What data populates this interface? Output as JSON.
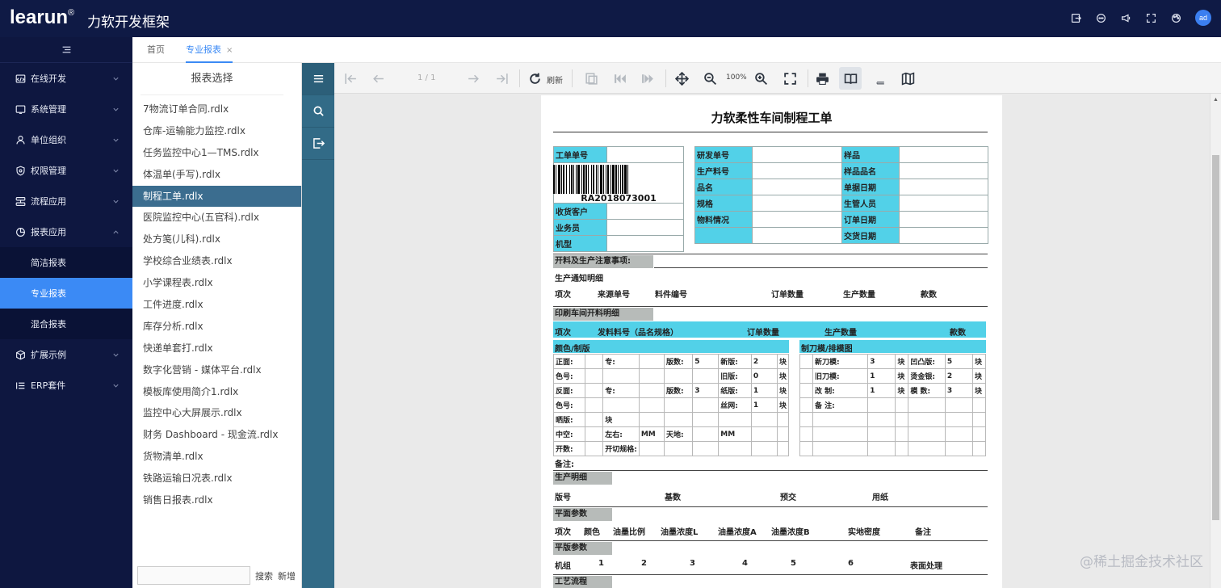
{
  "app": {
    "logo": "learun",
    "logo_mark": "®",
    "subtitle": "力软开发框架",
    "avatar": "ad"
  },
  "topbar_icons": [
    "export-icon",
    "message-icon",
    "notice-icon",
    "fullscreen-icon",
    "theme-icon"
  ],
  "sidebar": {
    "items": [
      {
        "label": "在线开发",
        "icon": "code-icon"
      },
      {
        "label": "系统管理",
        "icon": "settings-icon"
      },
      {
        "label": "单位组织",
        "icon": "org-icon"
      },
      {
        "label": "权限管理",
        "icon": "shield-icon"
      },
      {
        "label": "流程应用",
        "icon": "flow-icon"
      },
      {
        "label": "报表应用",
        "icon": "chart-icon"
      }
    ],
    "sub_items": [
      "简洁报表",
      "专业报表",
      "混合报表"
    ],
    "items_after": [
      {
        "label": "扩展示例",
        "icon": "box-icon"
      },
      {
        "label": "ERP套件",
        "icon": "list-icon"
      }
    ]
  },
  "tabs": {
    "home": "首页",
    "active": "专业报表",
    "close": "×"
  },
  "report_list": {
    "title": "报表选择",
    "items": [
      "7物流订单合同.rdlx",
      "仓库-运输能力监控.rdlx",
      "任务监控中心1—TMS.rdlx",
      "体温单(手写).rdlx",
      "制程工单.rdlx",
      "医院监控中心(五官科).rdlx",
      "处方笺(儿科).rdlx",
      "学校综合业绩表.rdlx",
      "小学课程表.rdlx",
      "工件进度.rdlx",
      "库存分析.rdlx",
      "快递单套打.rdlx",
      "数字化营销 - 媒体平台.rdlx",
      "模板库使用简介1.rdlx",
      "监控中心大屏展示.rdlx",
      "财务 Dashboard - 现金流.rdlx",
      "货物清单.rdlx",
      "铁路运输日况表.rdlx",
      "销售日报表.rdlx"
    ],
    "search_label": "搜索",
    "add_label": "新增"
  },
  "toolbar": {
    "page": "1 / 1",
    "refresh": "刷新",
    "zoom": "100%"
  },
  "report": {
    "title": "力软柔性车间制程工单",
    "barcode": "RA2018073001",
    "left_fields": [
      "工单单号",
      "收货客户",
      "业务员",
      "机型"
    ],
    "mid_fields": [
      "研发单号",
      "生产料号",
      "品名",
      "规格",
      "物料情况"
    ],
    "right_fields": [
      "样品",
      "样品品名",
      "单据日期",
      "生管人员",
      "订单日期",
      "交货日期"
    ],
    "notice": "开料及生产注意事项:",
    "prod_notice": "生产通知明细",
    "prod_cols": [
      "项次",
      "来源单号",
      "料件编号",
      "订单数量",
      "生产数量",
      "款数"
    ],
    "print_title": "印刷车间开料明细",
    "print_cols": [
      "项次",
      "发料料号（品名规格）",
      "订单数量",
      "生产数量",
      "款数"
    ],
    "color_title": "颜色/制版",
    "knife_title": "制刀模/排模图",
    "color_rows": [
      [
        "正面:",
        "",
        "专:",
        "",
        "版数:",
        "5",
        "新版:",
        "2",
        "块"
      ],
      [
        "色号:",
        "",
        "",
        "",
        "",
        "",
        "旧版:",
        "0",
        "块"
      ],
      [
        "反面:",
        "",
        "专:",
        "",
        "版数:",
        "3",
        "纸版:",
        "1",
        "块"
      ],
      [
        "色号:",
        "",
        "",
        "",
        "",
        "",
        "丝网:",
        "1",
        "块"
      ],
      [
        "晒版:",
        "",
        "块",
        "",
        "",
        "",
        "",
        "",
        ""
      ],
      [
        "中空:",
        "",
        "左右:",
        "MM",
        "天地:",
        "",
        "MM",
        "",
        ""
      ],
      [
        "开数:",
        "",
        "开切规格:",
        "",
        "",
        "",
        "",
        "",
        ""
      ]
    ],
    "knife_rows": [
      [
        "新刀模:",
        "3",
        "块",
        "凹凸版:",
        "5",
        "块"
      ],
      [
        "旧刀模:",
        "1",
        "块",
        "烫金银:",
        "2",
        "块"
      ],
      [
        "改 制:",
        "1",
        "块",
        "模 数:",
        "3",
        "块"
      ],
      [
        "备 注:",
        "",
        "",
        "",
        "",
        ""
      ]
    ],
    "remark": "备注:",
    "detail_title": "生产明细",
    "detail_cols": [
      "版号",
      "基数",
      "预交",
      "用纸"
    ],
    "plane_title": "平面参数",
    "plane_cols": [
      "项次",
      "颜色",
      "油墨比例",
      "油墨浓度L",
      "油墨浓度A",
      "油墨浓度B",
      "实地密度",
      "备注"
    ],
    "flat_title": "平版参数",
    "flat_cols": [
      "机组",
      "1",
      "2",
      "3",
      "4",
      "5",
      "6",
      "表面处理"
    ],
    "process_title": "工艺流程"
  },
  "watermark": "@稀土掘金技术社区"
}
